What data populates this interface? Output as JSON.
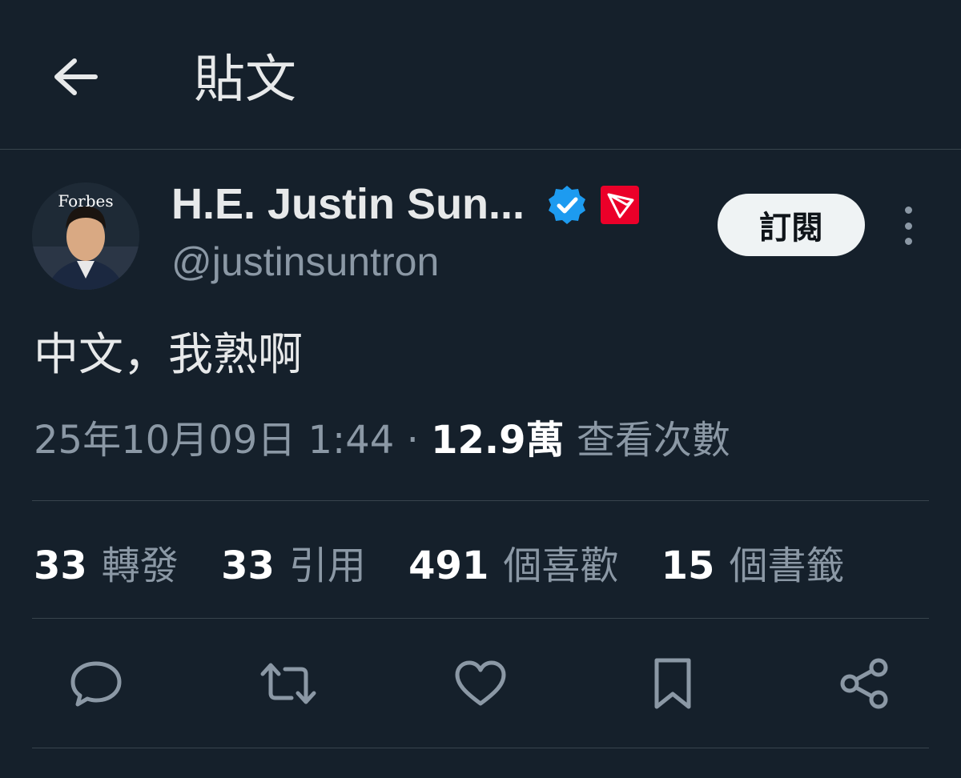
{
  "header": {
    "title": "貼文",
    "back_icon": "arrow-left-icon"
  },
  "author": {
    "display_name": "H.E. Justin Sun...",
    "handle": "@justinsuntron",
    "avatar_text": "Forbes",
    "verified_icon": "verified-badge-icon",
    "affiliate_icon": "tron-logo-icon"
  },
  "actions_top": {
    "subscribe_label": "訂閱",
    "more_icon": "more-vertical-icon"
  },
  "tweet": {
    "text": "中文，我熟啊"
  },
  "meta": {
    "date": "25年10月09日",
    "time": "1:44",
    "separator": "·",
    "views": "12.9萬",
    "views_label": "查看次數"
  },
  "stats": [
    {
      "count": "33",
      "label": "轉發"
    },
    {
      "count": "33",
      "label": "引用"
    },
    {
      "count": "491",
      "label": "個喜歡"
    },
    {
      "count": "15",
      "label": "個書籤"
    }
  ],
  "action_bar": [
    "reply-icon",
    "retweet-icon",
    "like-icon",
    "bookmark-icon",
    "share-icon"
  ],
  "colors": {
    "background": "#15202b",
    "text": "#e7e9ea",
    "muted": "#8b98a5",
    "divider": "#38444d",
    "verified": "#1d9bf0",
    "tron_red": "#eb0029"
  }
}
